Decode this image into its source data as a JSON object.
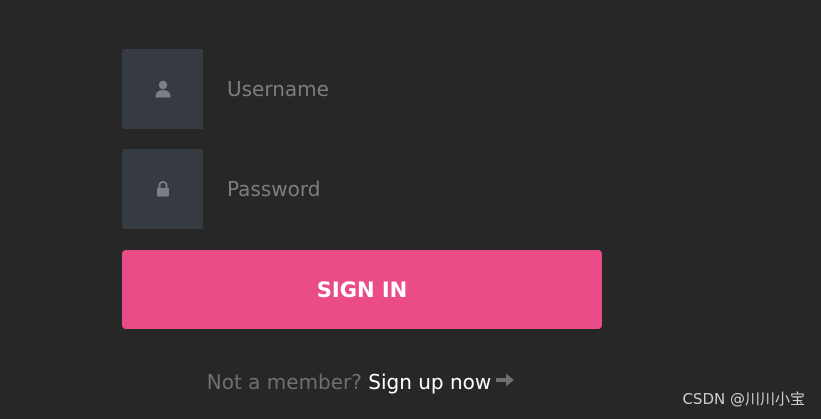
{
  "login_form": {
    "username": {
      "icon": "user-icon",
      "placeholder": "Username",
      "value": ""
    },
    "password": {
      "icon": "lock-icon",
      "placeholder": "Password",
      "value": ""
    },
    "signin_label": "SIGN IN",
    "signup_prompt": "Not a member?",
    "signup_link_label": "Sign up now",
    "signup_icon": "arrow-right-icon"
  },
  "watermark": "CSDN @川川小宝",
  "colors": {
    "background": "#272727",
    "icon_box": "#363b41",
    "accent": "#ea4c88",
    "placeholder_text": "#7d7d7d",
    "muted_text": "#6f6f6f",
    "link_text": "#ffffff"
  }
}
